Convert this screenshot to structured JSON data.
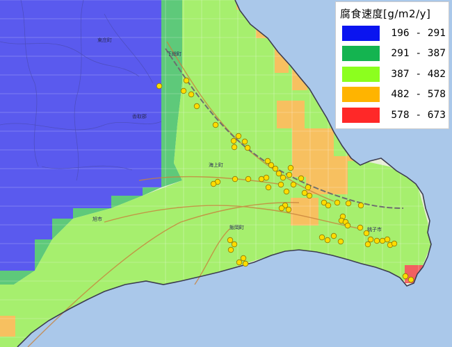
{
  "legend": {
    "title": "腐食速度[g/m2/y]",
    "items": [
      {
        "label": "196 - 291",
        "color": "#0a14f0"
      },
      {
        "label": "291 - 387",
        "color": "#14b450"
      },
      {
        "label": "387 - 482",
        "color": "#8cff1e"
      },
      {
        "label": "482 - 578",
        "color": "#ffb400"
      },
      {
        "label": "578 - 673",
        "color": "#ff2828"
      }
    ]
  },
  "colors": {
    "sea": "#aac8ea",
    "road": "#c8823c",
    "railway": "#6e6e6e",
    "coast_line": "#3c3c50",
    "survey_point": "#ffdc00",
    "survey_point_outline": "#8c7800"
  },
  "map_labels": [
    "東庄町",
    "香取郡",
    "下総町",
    "旭市",
    "海上町",
    "飯岡町",
    "銚子市"
  ]
}
